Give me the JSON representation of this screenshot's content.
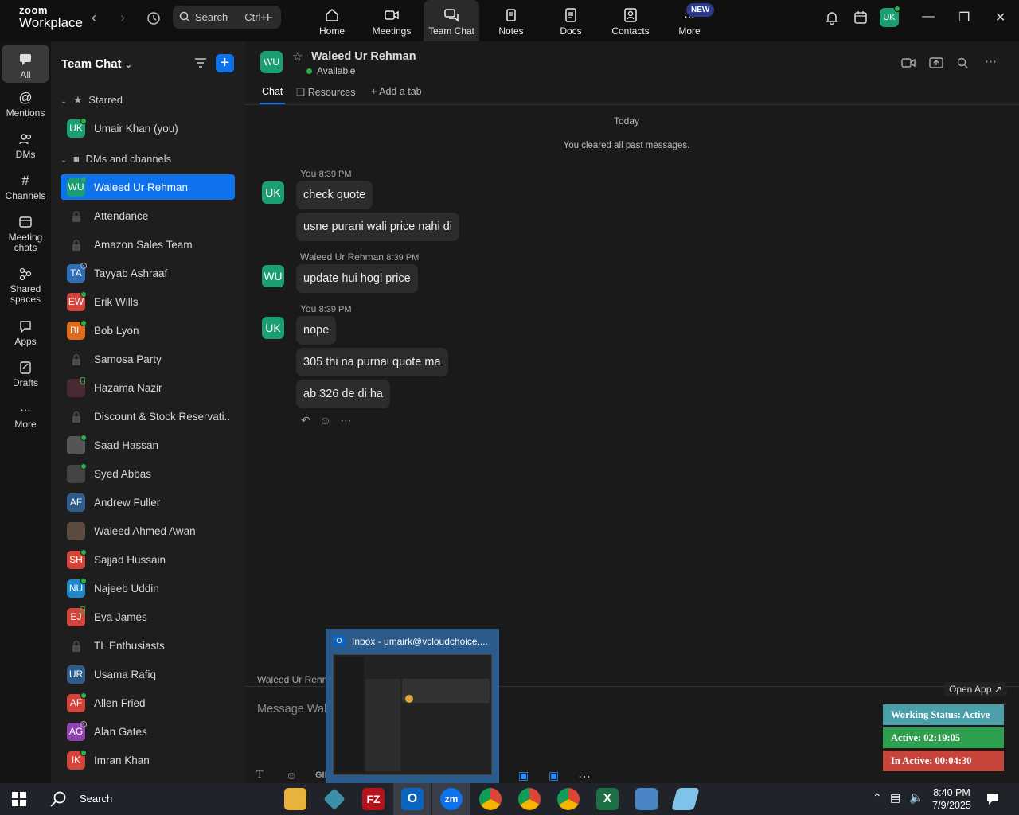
{
  "app": {
    "brand_line1": "zoom",
    "brand_line2": "Workplace",
    "search_label": "Search",
    "search_shortcut": "Ctrl+F",
    "new_badge": "NEW",
    "user_initials": "UK"
  },
  "topnav": [
    {
      "label": "Home",
      "icon": "home-icon"
    },
    {
      "label": "Meetings",
      "icon": "video-icon"
    },
    {
      "label": "Team Chat",
      "icon": "chat-icon",
      "active": true
    },
    {
      "label": "Notes",
      "icon": "notes-icon"
    },
    {
      "label": "Docs",
      "icon": "docs-icon"
    },
    {
      "label": "Contacts",
      "icon": "contacts-icon"
    },
    {
      "label": "More",
      "icon": "more-icon"
    }
  ],
  "rail": [
    {
      "label": "All",
      "icon": "chat-bubble-icon"
    },
    {
      "label": "Mentions",
      "icon": "at-icon"
    },
    {
      "label": "DMs",
      "icon": "people-icon"
    },
    {
      "label": "Channels",
      "icon": "hash-icon"
    },
    {
      "label1": "Meeting",
      "label2": "chats",
      "icon": "calendar-icon"
    },
    {
      "label1": "Shared",
      "label2": "spaces",
      "icon": "share-icon"
    },
    {
      "label": "Apps",
      "icon": "apps-icon"
    },
    {
      "label": "Drafts",
      "icon": "drafts-icon"
    },
    {
      "label": "More",
      "icon": "ellipsis-icon"
    }
  ],
  "panel": {
    "title": "Team Chat",
    "starred_header": "Starred",
    "dms_header": "DMs and channels",
    "starred": [
      {
        "initials": "UK",
        "name": "Umair Khan (you)",
        "color": "#1c9f70"
      }
    ],
    "contacts": [
      {
        "initials": "WU",
        "name": "Waleed Ur Rehman",
        "color": "#1c9f70"
      },
      {
        "initials": "",
        "name": "Attendance",
        "color": "#3a3a3a"
      },
      {
        "initials": "",
        "name": "Amazon Sales Team",
        "color": "#3a3a3a"
      },
      {
        "initials": "TA",
        "name": "Tayyab Ashraaf",
        "color": "#2d6db5"
      },
      {
        "initials": "EW",
        "name": "Erik Wills",
        "color": "#d3453a"
      },
      {
        "initials": "BL",
        "name": "Bob Lyon",
        "color": "#e06b1b"
      },
      {
        "initials": "",
        "name": "Samosa Party",
        "color": "#3a3a3a"
      },
      {
        "initials": "",
        "name": "Hazama Nazir",
        "color": "#4a2a32"
      },
      {
        "initials": "",
        "name": "Discount & Stock Reservati...",
        "color": "#3a3a3a"
      },
      {
        "initials": "",
        "name": "Saad Hassan",
        "color": "#555"
      },
      {
        "initials": "",
        "name": "Syed Abbas",
        "color": "#444"
      },
      {
        "initials": "AF",
        "name": "Andrew Fuller",
        "color": "#2d5c8a"
      },
      {
        "initials": "",
        "name": "Waleed Ahmed Awan",
        "color": "#5a4a40"
      },
      {
        "initials": "SH",
        "name": "Sajjad Hussain",
        "color": "#d3453a"
      },
      {
        "initials": "NU",
        "name": "Najeeb Uddin",
        "color": "#1f88c9"
      },
      {
        "initials": "EJ",
        "name": "Eva James",
        "color": "#d3453a"
      },
      {
        "initials": "",
        "name": "TL Enthusiasts",
        "color": "#3a3a3a"
      },
      {
        "initials": "UR",
        "name": "Usama Rafiq",
        "color": "#2d5c8a"
      },
      {
        "initials": "AF",
        "name": "Allen Fried",
        "color": "#d3453a"
      },
      {
        "initials": "AG",
        "name": "Alan Gates",
        "color": "#8e44ad"
      },
      {
        "initials": "IK",
        "name": "Imran Khan",
        "color": "#d3453a"
      }
    ]
  },
  "chat": {
    "peer_initials": "WU",
    "peer_name": "Waleed Ur Rehman",
    "peer_status": "Available",
    "tabs": [
      "Chat",
      "Resources",
      "Add a tab"
    ],
    "day_label": "Today",
    "cleared_notice": "You cleared all past messages.",
    "groups": [
      {
        "sender": "You",
        "time": "8:39 PM",
        "initials": "UK",
        "color": "#1c9f70",
        "messages": [
          "check quote",
          "usne purani wali price nahi di"
        ]
      },
      {
        "sender": "Waleed Ur Rehman",
        "time": "8:39 PM",
        "initials": "WU",
        "color": "#1c9f70",
        "messages": [
          "update hui hogi price"
        ]
      },
      {
        "sender": "You",
        "time": "8:39 PM",
        "initials": "UK",
        "color": "#1c9f70",
        "messages": [
          "nope",
          "305 thi na purnai quote ma",
          "ab 326 de di ha"
        ]
      }
    ],
    "composer_label": "Waleed Ur Rehm",
    "composer_placeholder": "Message Wal",
    "gif_label": "GIF"
  },
  "taskbar_preview": {
    "title": "Inbox - umairk@vcloudchoice...."
  },
  "overlay": {
    "open_app": "Open App ↗",
    "working_status": "Working Status: Active",
    "active_time": "Active: 02:19:05",
    "inactive_time": "In Active: 00:04:30",
    "status_color": "#4a9fa8",
    "active_color": "#2e9e4f",
    "inactive_color": "#c8453b"
  },
  "taskbar": {
    "search_label": "Search",
    "time": "8:40 PM",
    "date": "7/9/2025"
  }
}
